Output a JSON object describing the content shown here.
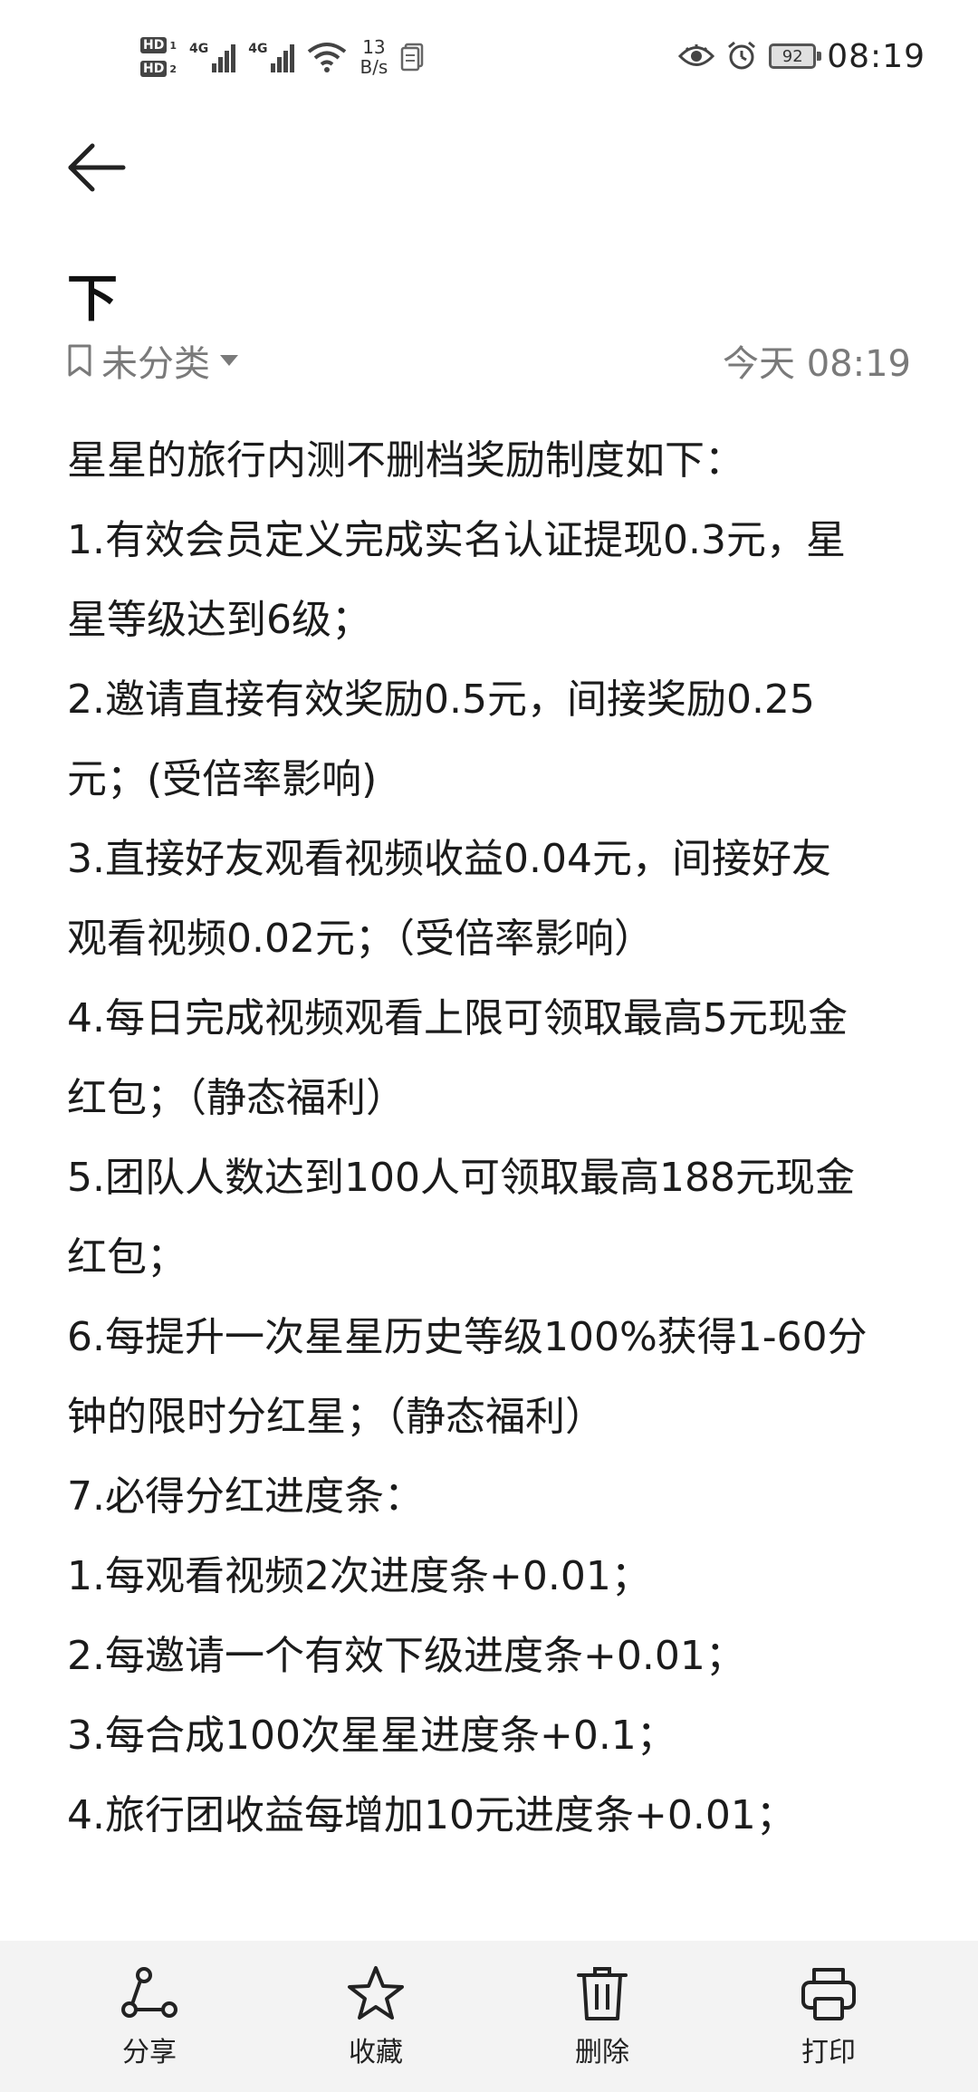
{
  "status_bar": {
    "hd1": "HD",
    "hd1_sub": "1",
    "hd2": "HD",
    "hd2_sub": "2",
    "signal1_label": "4G",
    "signal2_label": "4G",
    "net_speed_value": "13",
    "net_speed_unit": "B/s",
    "battery": "92",
    "time": "08:19"
  },
  "note": {
    "title_fragment": "下",
    "category": "未分类",
    "timestamp": "今天 08:19",
    "lines": [
      "星星的旅行内测不删档奖励制度如下：",
      "1.有效会员定义完成实名认证提现0.3元，星",
      "星等级达到6级；",
      "2.邀请直接有效奖励0.5元，间接奖励0.25",
      "元；(受倍率影响)",
      "3.直接好友观看视频收益0.04元，间接好友",
      "观看视频0.02元；（受倍率影响）",
      "4.每日完成视频观看上限可领取最高5元现金",
      "红包；（静态福利）",
      "5.团队人数达到100人可领取最高188元现金",
      "红包；",
      "6.每提升一次星星历史等级100%获得1-60分",
      "钟的限时分红星；（静态福利）",
      "7.必得分红进度条：",
      "1.每观看视频2次进度条+0.01；",
      "2.每邀请一个有效下级进度条+0.01；",
      "3.每合成100次星星进度条+0.1；",
      "4.旅行团收益每增加10元进度条+0.01；"
    ]
  },
  "toolbar": {
    "share": "分享",
    "favorite": "收藏",
    "delete": "删除",
    "print": "打印"
  }
}
